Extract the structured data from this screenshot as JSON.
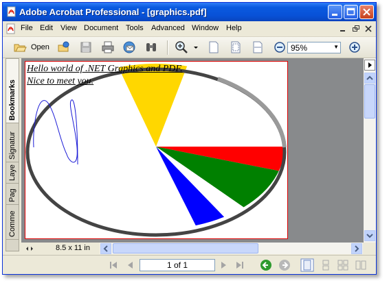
{
  "window": {
    "title": "Adobe Acrobat Professional - [graphics.pdf]"
  },
  "menu": [
    "File",
    "Edit",
    "View",
    "Document",
    "Tools",
    "Advanced",
    "Window",
    "Help"
  ],
  "toolbar": {
    "open_label": "Open",
    "zoom_value": "95%"
  },
  "navpanel": {
    "tabs": [
      "Bookmarks",
      "Signatur",
      "Laye",
      "Pag",
      "Comme"
    ]
  },
  "document": {
    "text_line1": "Hello world of .NET Graphics and PDF.",
    "text_line2": "Nice to meet you.",
    "pie_colors": [
      "#ffd700",
      "#ff0000",
      "#008000",
      "#ffffff",
      "#0000ff"
    ],
    "ink_color": "#1a1ad6"
  },
  "status": {
    "page_size": "8.5 x 11 in",
    "page_indicator": "1 of 1"
  }
}
